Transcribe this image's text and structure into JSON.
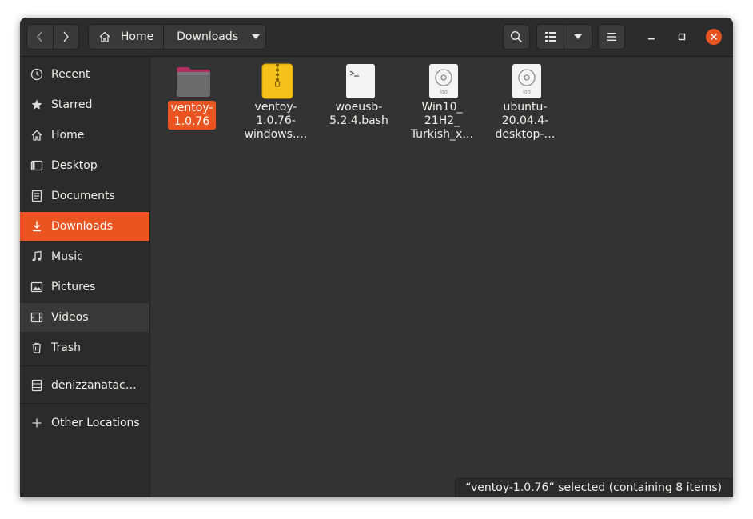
{
  "header": {
    "back_icon": "chevron-left-icon",
    "forward_icon": "chevron-right-icon",
    "breadcrumb": [
      {
        "label": "Home",
        "icon": "home-icon"
      },
      {
        "label": "Downloads"
      }
    ],
    "breadcrumb_menu_icon": "triangle-down-icon",
    "search_icon": "search-icon",
    "view_list_icon": "list-view-icon",
    "view_options_icon": "triangle-down-icon",
    "menu_icon": "hamburger-menu-icon",
    "window_controls": [
      "minimize-icon",
      "maximize-icon",
      "close-icon"
    ]
  },
  "sidebar": {
    "items": [
      {
        "label": "Recent",
        "icon": "clock-icon"
      },
      {
        "label": "Starred",
        "icon": "star-icon"
      },
      {
        "label": "Home",
        "icon": "home-icon"
      },
      {
        "label": "Desktop",
        "icon": "desktop-icon"
      },
      {
        "label": "Documents",
        "icon": "document-icon"
      },
      {
        "label": "Downloads",
        "icon": "download-icon",
        "active": true
      },
      {
        "label": "Music",
        "icon": "music-note-icon"
      },
      {
        "label": "Pictures",
        "icon": "picture-icon"
      },
      {
        "label": "Videos",
        "icon": "film-icon"
      },
      {
        "label": "Trash",
        "icon": "trash-icon"
      }
    ],
    "drives": [
      {
        "label": "denizzanatac…",
        "icon": "drive-icon"
      }
    ],
    "other": {
      "label": "Other Locations",
      "icon": "plus-icon"
    }
  },
  "files": [
    {
      "name_lines": [
        "ventoy-",
        "1.0.76"
      ],
      "icon": "folder-icon",
      "selected": true
    },
    {
      "name_lines": [
        "ventoy-",
        "1.0.76-",
        "windows.…"
      ],
      "icon": "zip-archive-icon"
    },
    {
      "name_lines": [
        "woeusb-",
        "5.2.4.bash"
      ],
      "icon": "script-icon"
    },
    {
      "name_lines": [
        "Win10_",
        "21H2_",
        "Turkish_x…"
      ],
      "icon": "iso-disc-icon",
      "badge": "iso"
    },
    {
      "name_lines": [
        "ubuntu-",
        "20.04.4-",
        "desktop-…"
      ],
      "icon": "iso-disc-icon",
      "badge": "iso"
    }
  ],
  "status_bar": "“ventoy-1.0.76” selected  (containing 8 items)",
  "colors": {
    "accent": "#e95420",
    "window": "#333333",
    "sidebar": "#2b2b2b",
    "folder": "#6b6b6b",
    "folder_tab": "#b03060",
    "archive": "#f4c21b"
  }
}
